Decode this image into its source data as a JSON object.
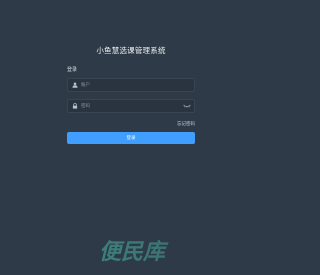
{
  "app": {
    "title": "小鱼慧选课管理系统"
  },
  "form": {
    "section_label": "登录",
    "username": {
      "placeholder": "账户",
      "value": "",
      "icon": "user-icon"
    },
    "password": {
      "placeholder": "密码",
      "value": "",
      "icon": "lock-icon",
      "toggle_icon": "eye-closed-icon"
    },
    "forgot_label": "忘记密码",
    "submit_label": "登录"
  },
  "watermark": {
    "text": "便民库",
    "subtitle": ""
  },
  "colors": {
    "background": "#2e3a47",
    "field_background": "#2a3440",
    "accent": "#409eff",
    "watermark": "#4ab8a8"
  }
}
